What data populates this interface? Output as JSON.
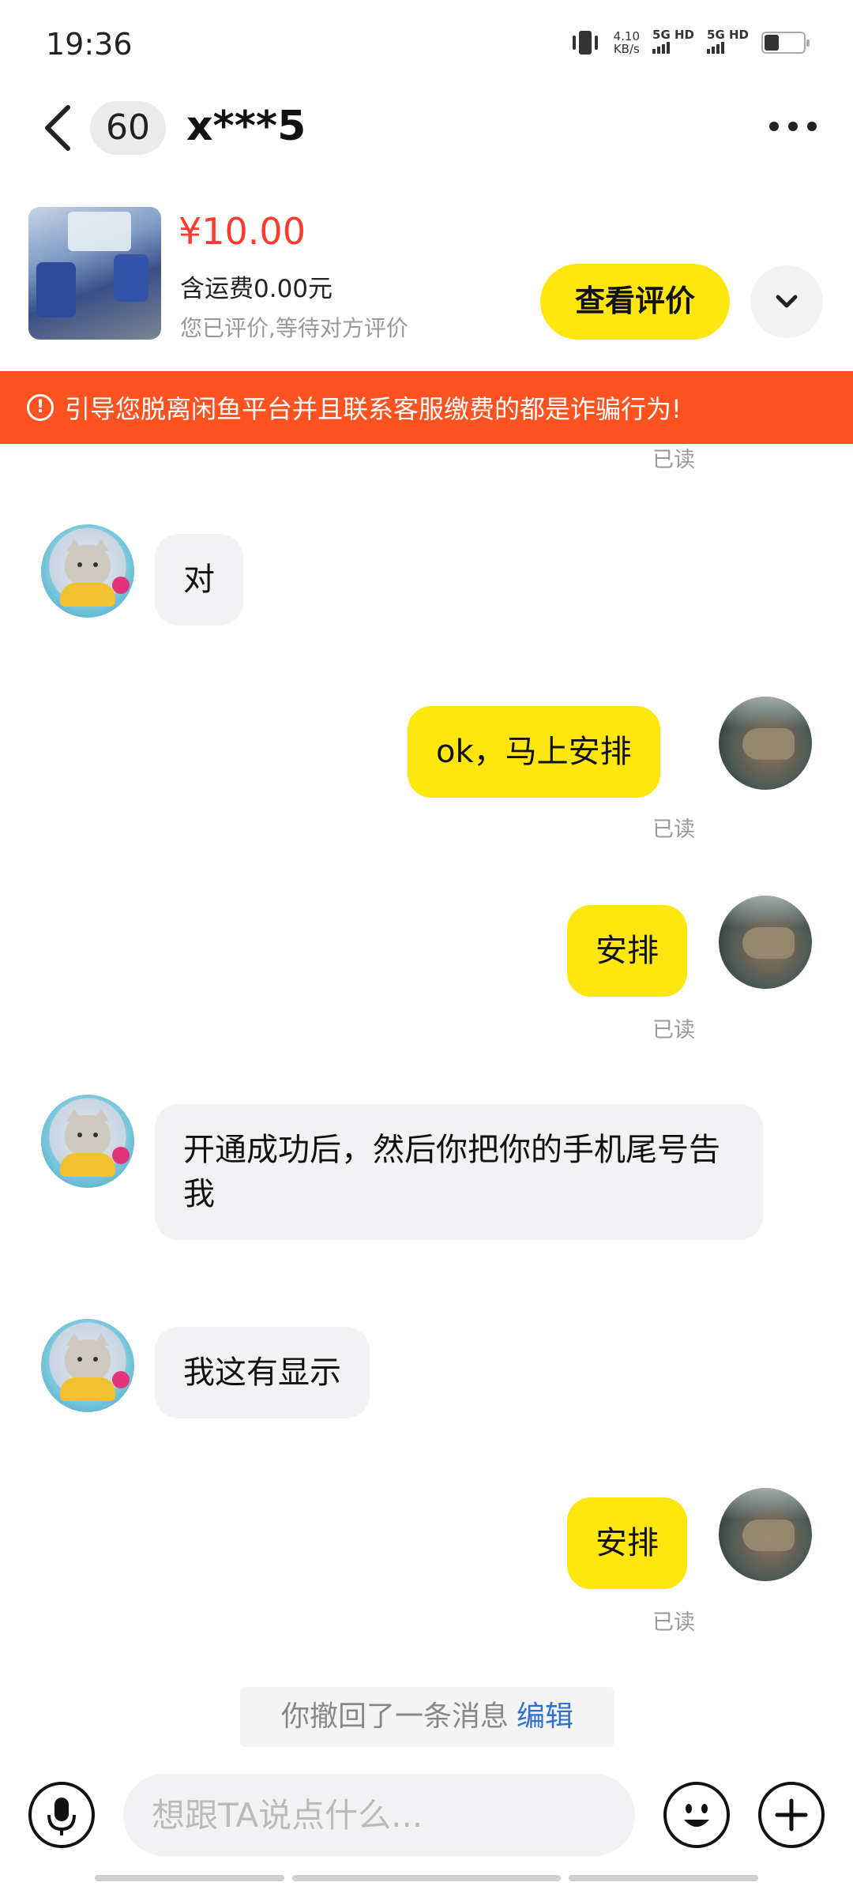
{
  "status_bar": {
    "time": "19:36",
    "speed_value": "4.10",
    "speed_unit": "KB/s",
    "network1": "5G HD",
    "network2": "5G HD",
    "battery_percent": 30
  },
  "header": {
    "unread_count": "60",
    "contact_name": "x***5"
  },
  "product": {
    "price": "¥10.00",
    "shipping": "含运费0.00元",
    "status": "您已评价,等待对方评价",
    "review_button": "查看评价"
  },
  "warning": {
    "text": "引导您脱离闲鱼平台并且联系客服缴费的都是诈骗行为!"
  },
  "messages": [
    {
      "direction": "incoming",
      "text": "对"
    },
    {
      "direction": "outgoing",
      "text": "ok，马上安排",
      "read": "已读"
    },
    {
      "direction": "outgoing",
      "text": "安排",
      "read": "已读"
    },
    {
      "direction": "incoming",
      "text": "开通成功后，然后你把你的手机尾号告我"
    },
    {
      "direction": "incoming",
      "text": "我这有显示"
    },
    {
      "direction": "outgoing",
      "text": "安排",
      "read": "已读"
    }
  ],
  "top_read_label": "已读",
  "recall_notice": {
    "text": "你撤回了一条消息",
    "edit": "编辑"
  },
  "input": {
    "placeholder": "想跟TA说点什么..."
  },
  "colors": {
    "accent_yellow": "#ffe60f",
    "warning_orange": "#ff5221",
    "price_red": "#ff3b30",
    "link_blue": "#2f6fcf"
  }
}
